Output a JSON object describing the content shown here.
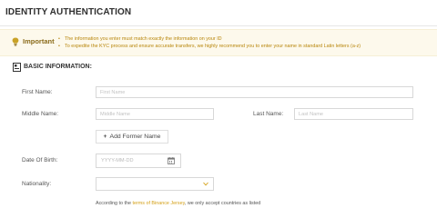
{
  "header": {
    "title": "IDENTITY AUTHENTICATION"
  },
  "notice": {
    "label": "Important",
    "items": [
      "The information you enter must match exactly the information on your ID",
      "To expedite the KYC process and ensure accurate transfers, we highly recommend you to enter your name in standard Latin letters (a-z)"
    ]
  },
  "section": {
    "title": "BASIC INFORMATION:"
  },
  "form": {
    "first_name": {
      "label": "First Name:",
      "placeholder": "First Name"
    },
    "middle_name": {
      "label": "Middle Name:",
      "placeholder": "Middle Name"
    },
    "last_name": {
      "label": "Last Name:",
      "placeholder": "Last Name"
    },
    "add_former_name": {
      "icon": "plus-icon",
      "label": "Add Former Name"
    },
    "date_of_birth": {
      "label": "Date Of Birth:",
      "placeholder": "YYYY-MM-DD",
      "icon": "calendar-icon"
    },
    "nationality": {
      "label": "Nationality:",
      "value": "",
      "icon": "chevron-down-icon"
    },
    "note": {
      "prefix": "According to the ",
      "link": "terms of Binance Jersey",
      "suffix": ", we only accept countries as listed"
    }
  },
  "colors": {
    "accent": "#d4a017",
    "notice_bg": "#fdf9ec",
    "border": "#d8d8d8"
  }
}
